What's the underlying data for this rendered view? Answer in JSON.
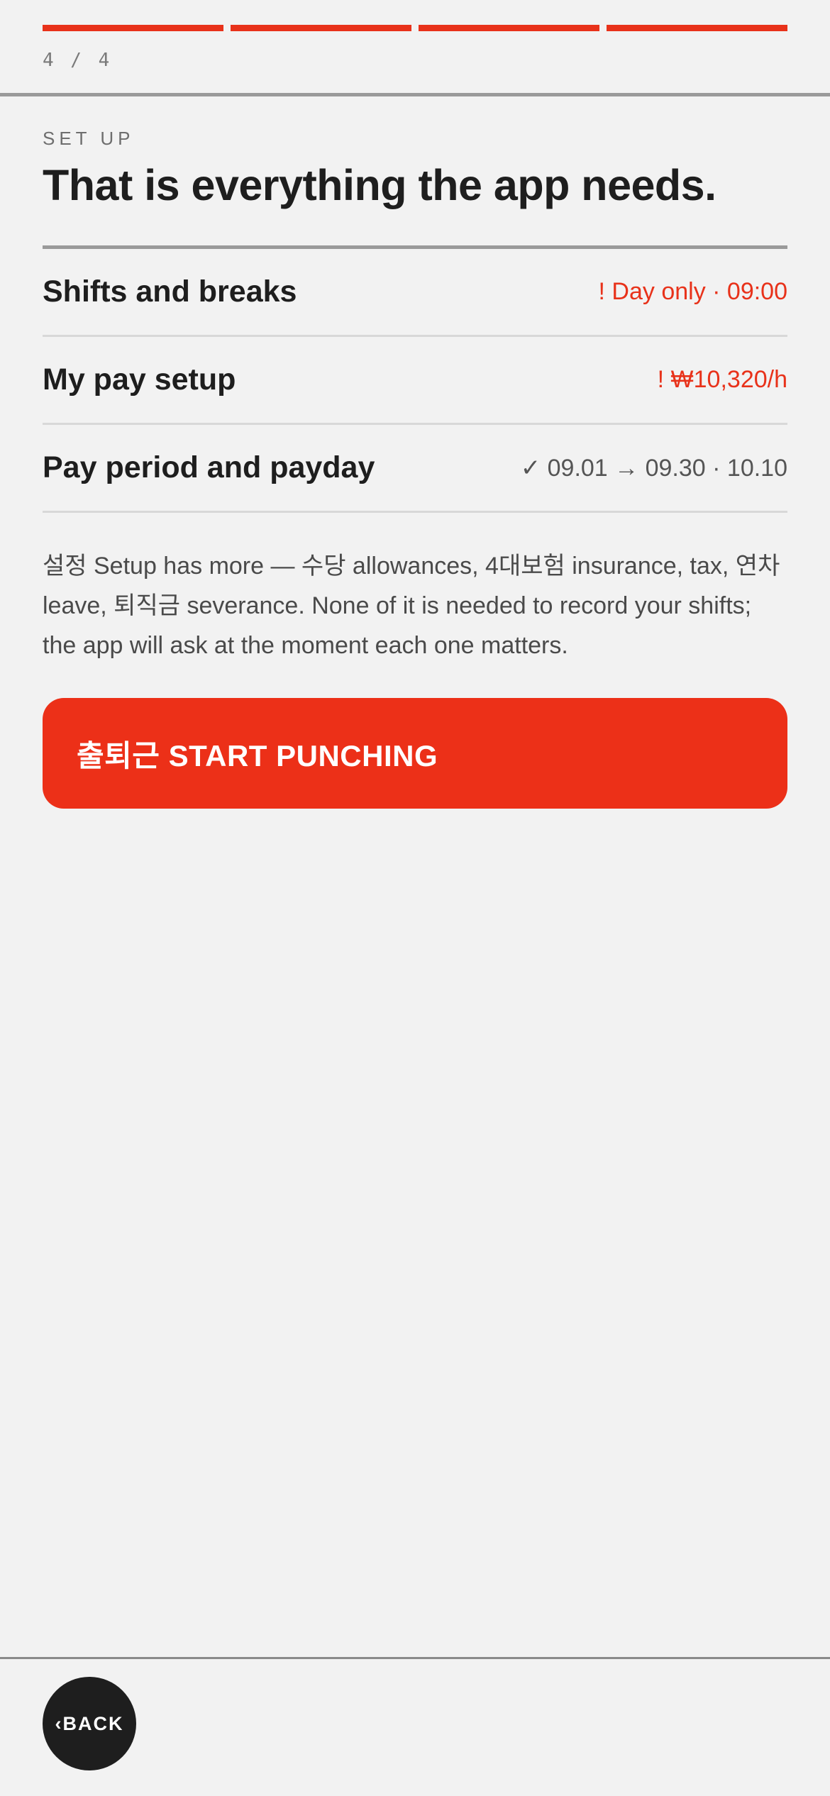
{
  "progress": {
    "counter": "4 / 4",
    "steps": 4,
    "completed": 4,
    "accent_color": "#e8321a"
  },
  "header": {
    "eyebrow": "SET UP",
    "title": "That is everything the app needs."
  },
  "summary": {
    "items": [
      {
        "label": "Shifts and breaks",
        "value": "! Day only · 09:00",
        "status": "warning"
      },
      {
        "label": "My pay setup",
        "value": "! ₩10,320/h",
        "status": "warning"
      },
      {
        "label": "Pay period and payday",
        "value": "✓ 09.01 → 09.30 · 10.10",
        "status": "done"
      }
    ]
  },
  "note": "설정 Setup has more — 수당 allowances, 4대보험 insurance, tax, 연차 leave, 퇴직금 severance. None of it is needed to record your shifts; the app will ask at the moment each one matters.",
  "actions": {
    "primary_label": "출퇴근 START PUNCHING",
    "primary_color": "#ec3018",
    "back_label": "‹BACK"
  }
}
